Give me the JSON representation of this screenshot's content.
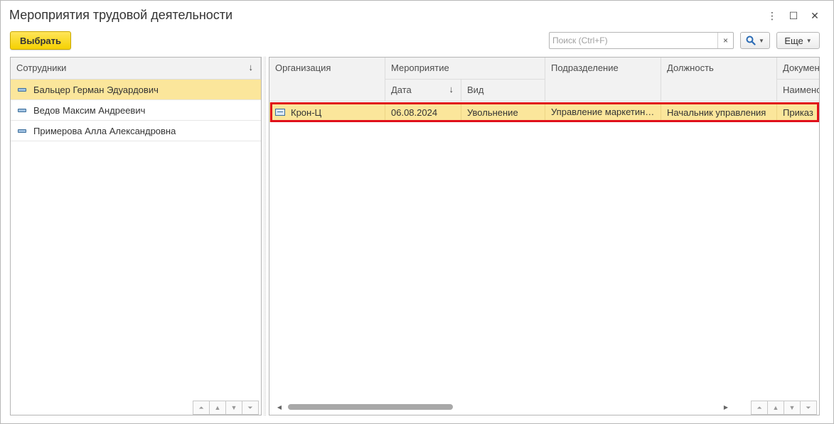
{
  "window": {
    "title": "Мероприятия трудовой деятельности",
    "controls": {
      "menu": "⋮",
      "maximize": "☐",
      "close": "✕"
    }
  },
  "toolbar": {
    "select_label": "Выбрать",
    "search_placeholder": "Поиск (Ctrl+F)",
    "search_clear": "×",
    "search_button_icon": "search-icon",
    "more_label": "Еще"
  },
  "employees": {
    "header": "Сотрудники",
    "sort_indicator": "↓",
    "items": [
      {
        "name": "Бальцер Герман Эдуардович",
        "selected": true
      },
      {
        "name": "Ведов Максим Андреевич",
        "selected": false
      },
      {
        "name": "Примерова Алла Александровна",
        "selected": false
      }
    ]
  },
  "events": {
    "headers": {
      "organization": "Организация",
      "event": "Мероприятие",
      "date": "Дата",
      "date_sort": "↓",
      "type": "Вид",
      "department": "Подразделение",
      "position": "Должность",
      "document": "Докумен",
      "doc_name": "Наименс"
    },
    "rows": [
      {
        "organization": "Крон-Ц",
        "date": "06.08.2024",
        "type": "Увольнение",
        "department": "Управление маркетин…",
        "position": "Начальник управления",
        "doc_name": "Приказ"
      }
    ]
  },
  "colors": {
    "accent_yellow": "#f5d100",
    "selection": "#fbe69b",
    "highlight_border": "#e0101a"
  }
}
